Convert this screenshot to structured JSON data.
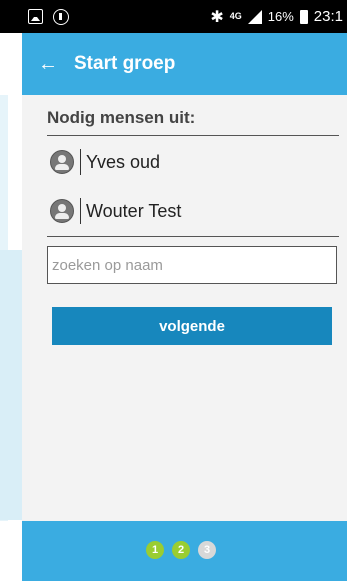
{
  "status_bar": {
    "network": "4G",
    "battery": "16%",
    "time": "23:1"
  },
  "app_bar": {
    "title": "Start groep"
  },
  "invite": {
    "title": "Nodig mensen uit:",
    "people": [
      "Yves oud",
      "Wouter Test"
    ]
  },
  "search": {
    "value": "",
    "placeholder": "zoeken op naam"
  },
  "next_button": "volgende",
  "steps": [
    {
      "label": "1",
      "state": "done"
    },
    {
      "label": "2",
      "state": "done"
    },
    {
      "label": "3",
      "state": "todo"
    }
  ],
  "colors": {
    "primary": "#3aace1",
    "button": "#1787bd",
    "step_done": "#9acd32",
    "step_todo": "#d8d8d8"
  }
}
